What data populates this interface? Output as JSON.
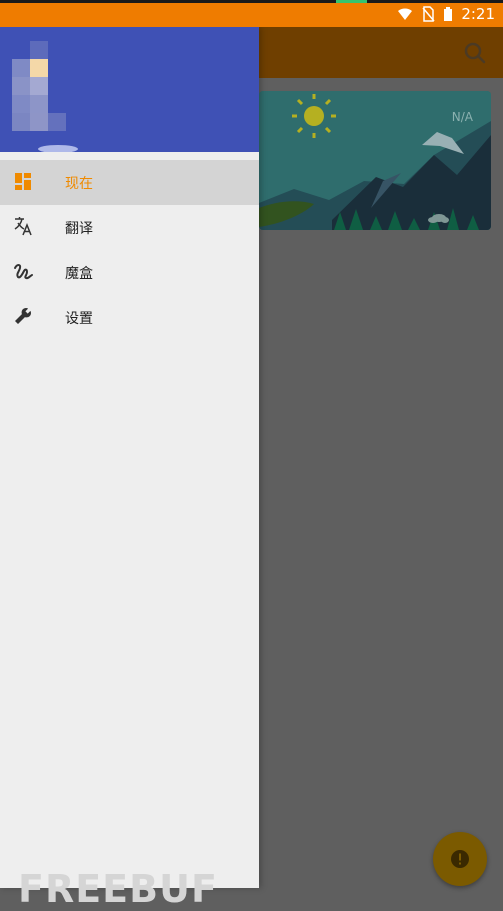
{
  "status_bar": {
    "time": "2:21",
    "icons": [
      "wifi-icon",
      "no-sim-icon",
      "battery-icon"
    ],
    "colors": {
      "background": "#ef7c00"
    }
  },
  "app_bar": {
    "background": "#6f3f00",
    "search_icon": "search-icon"
  },
  "weather_card": {
    "temperature": "N/A",
    "icons": [
      "sun-icon",
      "cloud-icon"
    ]
  },
  "drawer": {
    "header_color": "#3f51b5",
    "items": [
      {
        "label": "现在",
        "icon": "dashboard-icon",
        "active": true
      },
      {
        "label": "翻译",
        "icon": "translate-icon",
        "active": false
      },
      {
        "label": "魔盒",
        "icon": "gesture-icon",
        "active": false
      },
      {
        "label": "设置",
        "icon": "wrench-icon",
        "active": false
      }
    ]
  },
  "fab": {
    "icon": "alert-icon"
  },
  "watermark": {
    "text": "FREEBUF"
  }
}
